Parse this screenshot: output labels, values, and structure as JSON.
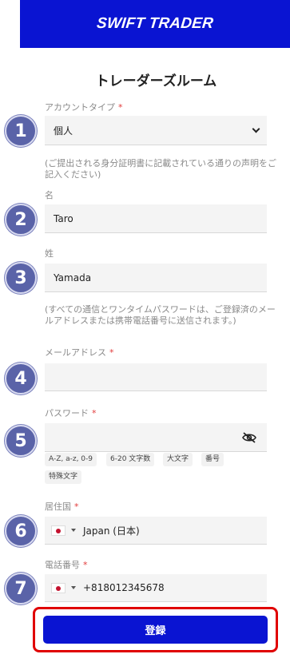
{
  "header": {
    "logo_text": "SWIFT TRADER"
  },
  "page": {
    "title": "トレーダーズルーム"
  },
  "account_type": {
    "label": "アカウントタイプ",
    "required_mark": "*",
    "value": "個人"
  },
  "name_note": "(ご提出される身分証明書に記載されている通りの声明をご記入ください)",
  "first_name": {
    "label": "名",
    "value": "Taro"
  },
  "last_name": {
    "label": "姓",
    "value": "Yamada"
  },
  "email_note": "(すべての通信とワンタイムパスワードは、ご登録済のメールアドレスまたは携帯電話番号に送信されます。)",
  "email": {
    "label": "メールアドレス",
    "required_mark": "*",
    "value": ""
  },
  "password": {
    "label": "パスワード",
    "required_mark": "*",
    "value": "",
    "rules": [
      "A-Z, a-z, 0-9",
      "6-20 文字数",
      "大文字",
      "番号",
      "特殊文字"
    ]
  },
  "country": {
    "label": "居住国",
    "required_mark": "*",
    "value": "Japan (日本)"
  },
  "phone": {
    "label": "電話番号",
    "required_mark": "*",
    "value": "+818012345678"
  },
  "submit_label": "登録",
  "step_badges": [
    "1",
    "2",
    "3",
    "4",
    "5",
    "6",
    "7"
  ],
  "colors": {
    "brand": "#0a14d2",
    "highlight": "#e00000",
    "badge": "#5a63a8",
    "required": "#e23b3b"
  }
}
